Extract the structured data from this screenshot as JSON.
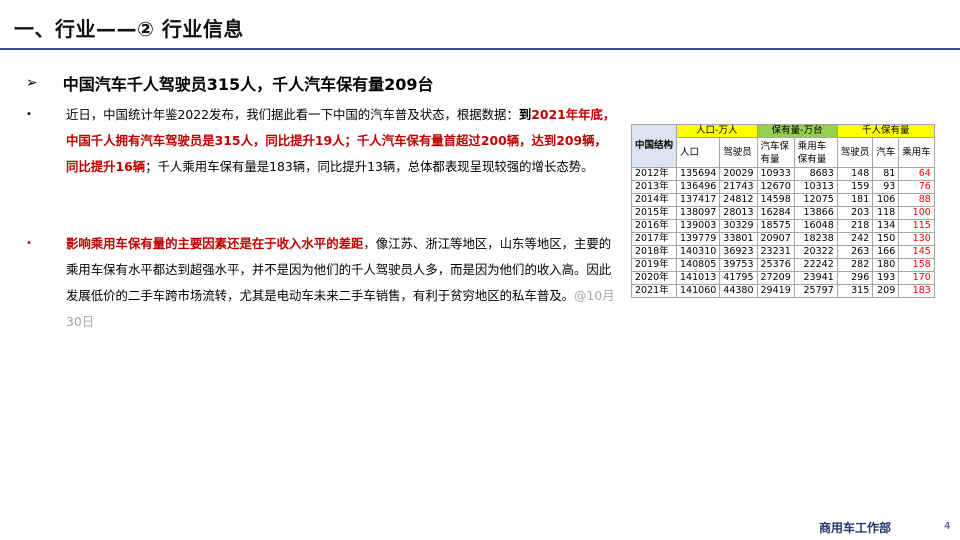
{
  "header": {
    "title": "一、行业——② 行业信息"
  },
  "subhead": {
    "arrow": "➢",
    "text": "中国汽车千人驾驶员315人，千人汽车保有量209台"
  },
  "para1": {
    "bullet": "•",
    "t1": "近日，中国统计年鉴2022发布，我们据此看一下中国的汽车普及状态，根据数据：",
    "t2": "到",
    "t3": "2021年年底，中国千人拥有汽车驾驶员是315人，同比提升19人；千人汽车保有量首超过200辆，达到209辆，同比提升16辆",
    "t4": "；千人乘用车保有量是183辆，同比提升13辆，总体都表现呈现较强的增长态势。"
  },
  "para2": {
    "bullet": "•",
    "t1": "影响乘用车保有量的主要因素还是在于收入水平的差距",
    "t2": "，像江苏、浙江等地区，山东等地区，主要的乘用车保有水平都达到超强水平，并不是因为他们的千人驾驶员人多，而是因为他们的收入高。因此发展低价的二手车跨市场流转，尤其是电动车未来二手车销售，有利于贫穷地区的私车普及。",
    "t3": "@10月30日"
  },
  "table": {
    "corner": "中国结构",
    "groups": [
      "人口-万人",
      "保有量-万台",
      "千人保有量"
    ],
    "columns": [
      "人口",
      "驾驶员",
      "汽车保有量",
      "乘用车保有量",
      "驾驶员",
      "汽车",
      "乘用车"
    ],
    "rows": [
      [
        "2012年",
        "135694",
        "20029",
        "10933",
        "8683",
        "148",
        "81",
        "64"
      ],
      [
        "2013年",
        "136496",
        "21743",
        "12670",
        "10313",
        "159",
        "93",
        "76"
      ],
      [
        "2014年",
        "137417",
        "24812",
        "14598",
        "12075",
        "181",
        "106",
        "88"
      ],
      [
        "2015年",
        "138097",
        "28013",
        "16284",
        "13866",
        "203",
        "118",
        "100"
      ],
      [
        "2016年",
        "139003",
        "30329",
        "18575",
        "16048",
        "218",
        "134",
        "115"
      ],
      [
        "2017年",
        "139779",
        "33801",
        "20907",
        "18238",
        "242",
        "150",
        "130"
      ],
      [
        "2018年",
        "140310",
        "36923",
        "23231",
        "20322",
        "263",
        "166",
        "145"
      ],
      [
        "2019年",
        "140805",
        "39753",
        "25376",
        "22242",
        "282",
        "180",
        "158"
      ],
      [
        "2020年",
        "141013",
        "41795",
        "27209",
        "23941",
        "296",
        "193",
        "170"
      ],
      [
        "2021年",
        "141060",
        "44380",
        "29419",
        "25797",
        "315",
        "209",
        "183"
      ]
    ]
  },
  "footer": {
    "brand": "商用车工作部",
    "page": "4"
  },
  "colors": {
    "accent_line": "#2f4f8f",
    "highlight_red": "#c00000",
    "yellow": "#ffff00",
    "green": "#92d050"
  }
}
